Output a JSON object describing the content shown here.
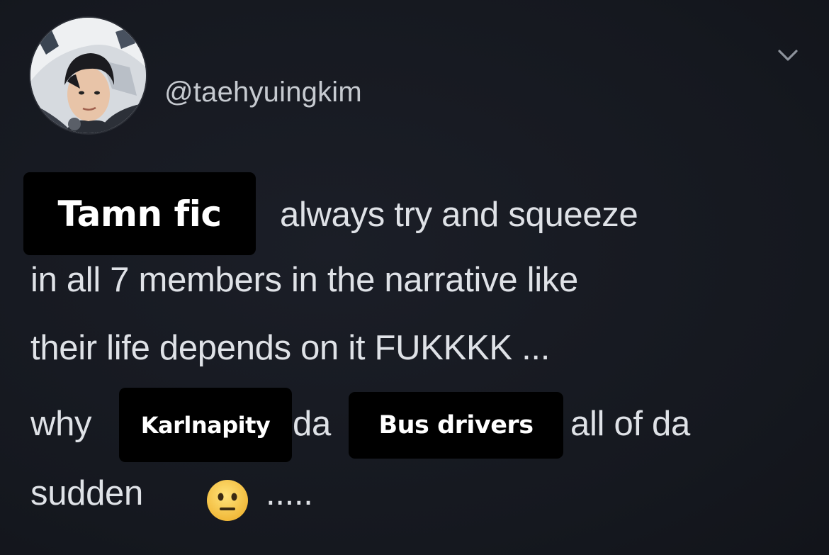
{
  "tweet": {
    "handle": "@taehyuingkim",
    "body": {
      "line1_end": "always try and squeeze",
      "line2": "in all 7 members in the narrative like",
      "line3": "their life depends on it FUKKKK ...",
      "line4_a": "why",
      "line4_b": "da",
      "line4_c": "all of da",
      "line5_a": "sudden",
      "line5_b": "....."
    },
    "emoji_name": "neutral-face",
    "overlay_labels": [
      "Tamn fic",
      "Karlnapity",
      "Bus drivers"
    ]
  }
}
